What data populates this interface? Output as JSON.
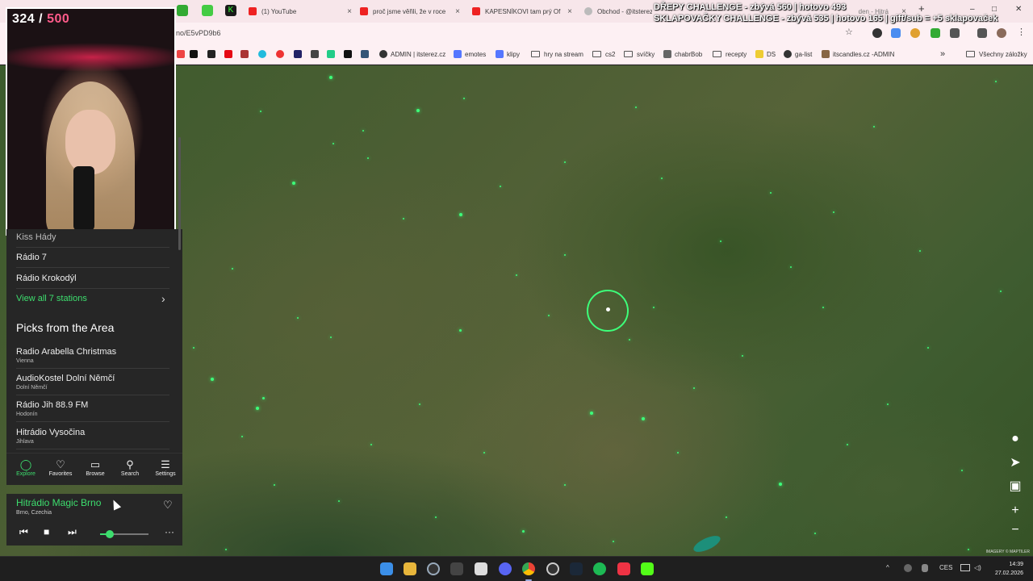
{
  "tabs": {
    "pinned_kick": "K",
    "close": "×",
    "new_tab": "+",
    "list": [
      {
        "title": "(1) YouTube"
      },
      {
        "title": "proč jsme věřili, že v roce"
      },
      {
        "title": "KAPESNÍKOVI tam prý Of"
      },
      {
        "title": "Obchod - @itsterez"
      },
      {
        "title": "den - Hitrá"
      }
    ]
  },
  "window": {
    "minimize": "–",
    "maximize": "□",
    "close": "✕"
  },
  "toolbar": {
    "url": "no/E5vPD9b6",
    "star": "☆",
    "menu": "⋮"
  },
  "bookmarks": {
    "items": [
      "ADMIN | itsterez.cz",
      "emotes",
      "klipy",
      "hry na stream",
      "cs2",
      "svíčky",
      "chabrBob",
      "recepty",
      "DS",
      "ga-list",
      "itscandles.cz -ADMIN"
    ],
    "overflow": "»",
    "all": "Všechny záložky"
  },
  "overlay": {
    "line1": "DŘEPY CHALLENGE - zbývá 560 | hotovo 493",
    "line2": "SKLAPOVAČKY CHALLENGE - zbývá 535 | hotovo 165 | gift/sub = +5 sklapovaček",
    "goal_current": "324",
    "goal_sep": "/",
    "goal_target": "500"
  },
  "panel": {
    "top_stations": [
      "Kiss Hády",
      "Rádio 7",
      "Rádio Krokodýl"
    ],
    "view_all": "View all 7 stations",
    "chevron": "›",
    "picks_title": "Picks from the Area",
    "picks": [
      {
        "name": "Radio Arabella Christmas",
        "city": "Vienna"
      },
      {
        "name": "AudioKostel Dolní Němčí",
        "city": "Dolní Němčí"
      },
      {
        "name": "Rádio Jih 88.9 FM",
        "city": "Hodonín"
      },
      {
        "name": "Hitrádio Vysočina",
        "city": "Jihlava"
      }
    ]
  },
  "nav": {
    "items": [
      {
        "label": "Explore",
        "glyph": "◯"
      },
      {
        "label": "Favorites",
        "glyph": "♡"
      },
      {
        "label": "Browse",
        "glyph": "▭"
      },
      {
        "label": "Search",
        "glyph": "⚲"
      },
      {
        "label": "Settings",
        "glyph": "☰"
      }
    ]
  },
  "player": {
    "title": "Hitrádio Magic Brno",
    "location": "Brno, Czechia",
    "heart": "♡",
    "prev": "⏮",
    "stop": "■",
    "next": "⏭",
    "more": "···",
    "volume": 0.2
  },
  "map": {
    "zoom_in": "+",
    "zoom_out": "−",
    "attribution": "IMAGERY © MAPTILER"
  },
  "taskbar": {
    "tray_chevron": "^",
    "lang": "CES",
    "speaker": "◁)",
    "time": "14:39",
    "date": "27.02.2026"
  },
  "colors": {
    "accent": "#3dde6e",
    "marker": "#3dff7a",
    "panel_bg": "#262626",
    "goal_target": "#ff5b8a"
  }
}
